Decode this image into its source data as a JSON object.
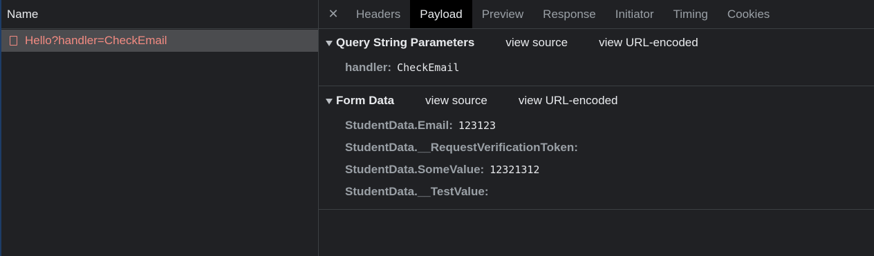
{
  "list": {
    "header": "Name",
    "request_name": "Hello?handler=CheckEmail"
  },
  "tabs": {
    "close": "✕",
    "items": [
      "Headers",
      "Payload",
      "Preview",
      "Response",
      "Initiator",
      "Timing",
      "Cookies"
    ],
    "active": "Payload"
  },
  "query": {
    "title": "Query String Parameters",
    "view_source": "view source",
    "view_url": "view URL-encoded",
    "params": [
      {
        "key": "handler:",
        "value": "CheckEmail"
      }
    ]
  },
  "form": {
    "title": "Form Data",
    "view_source": "view source",
    "view_url": "view URL-encoded",
    "params": [
      {
        "key": "StudentData.Email:",
        "value": "123123"
      },
      {
        "key": "StudentData.__RequestVerificationToken:",
        "value": ""
      },
      {
        "key": "StudentData.SomeValue:",
        "value": "12321312"
      },
      {
        "key": "StudentData.__TestValue:",
        "value": ""
      }
    ]
  },
  "colors": {
    "background": "#202124",
    "error_red": "#f28b82",
    "active_tab": "#000000",
    "selected_row": "#4b4c4f"
  }
}
